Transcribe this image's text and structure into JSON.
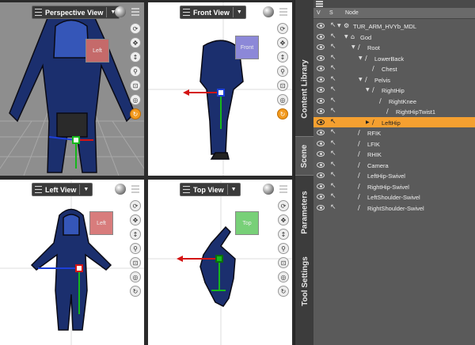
{
  "viewports": {
    "perspective": {
      "title": "Perspective View",
      "cube_label": "Left"
    },
    "front": {
      "title": "Front View",
      "cube_label": "Front"
    },
    "left": {
      "title": "Left View",
      "cube_label": "Left"
    },
    "top": {
      "title": "Top View",
      "cube_label": "Top"
    }
  },
  "sidebar": {
    "tabs": [
      "Content Library",
      "Scene",
      "Parameters",
      "Tool Settings"
    ],
    "active_tab": "Scene"
  },
  "scene_panel": {
    "columns": [
      "V",
      "S",
      "Node"
    ],
    "nodes": [
      {
        "label": "TUR_ARM_HVYb_MDL",
        "depth": 0,
        "expanded": true,
        "icon": "figure-icon"
      },
      {
        "label": "God",
        "depth": 1,
        "expanded": true,
        "icon": "group-icon"
      },
      {
        "label": "Root",
        "depth": 2,
        "expanded": true,
        "icon": "bone-icon"
      },
      {
        "label": "LowerBack",
        "depth": 3,
        "expanded": true,
        "icon": "bone-icon"
      },
      {
        "label": "Chest",
        "depth": 4,
        "expanded": false,
        "icon": "bone-icon"
      },
      {
        "label": "Pelvis",
        "depth": 3,
        "expanded": true,
        "icon": "bone-icon"
      },
      {
        "label": "RightHip",
        "depth": 4,
        "expanded": true,
        "icon": "bone-icon"
      },
      {
        "label": "RightKnee",
        "depth": 5,
        "expanded": false,
        "icon": "bone-icon"
      },
      {
        "label": "RightHipTwist1",
        "depth": 6,
        "expanded": false,
        "icon": "bone-icon"
      },
      {
        "label": "LeftHip",
        "depth": 4,
        "expanded": false,
        "icon": "bone-icon",
        "selected": true
      },
      {
        "label": "RFIK",
        "depth": 2,
        "expanded": false,
        "icon": "bone-icon"
      },
      {
        "label": "LFIK",
        "depth": 2,
        "expanded": false,
        "icon": "bone-icon"
      },
      {
        "label": "RHIK",
        "depth": 2,
        "expanded": false,
        "icon": "bone-icon"
      },
      {
        "label": "Camera",
        "depth": 2,
        "expanded": false,
        "icon": "bone-icon"
      },
      {
        "label": "LeftHip-Swivel",
        "depth": 2,
        "expanded": false,
        "icon": "bone-icon"
      },
      {
        "label": "RightHip-Swivel",
        "depth": 2,
        "expanded": false,
        "icon": "bone-icon"
      },
      {
        "label": "LeftShoulder-Swivel",
        "depth": 2,
        "expanded": false,
        "icon": "bone-icon"
      },
      {
        "label": "RightShoulder-Swivel",
        "depth": 2,
        "expanded": false,
        "icon": "bone-icon"
      }
    ]
  },
  "colors": {
    "selection": "#f5a030",
    "panel_bg": "#5a5a5a",
    "armor_blue": "#1f3a8a",
    "gizmo_red": "#d41414",
    "gizmo_green": "#16b81b",
    "gizmo_blue": "#1e40d8"
  }
}
